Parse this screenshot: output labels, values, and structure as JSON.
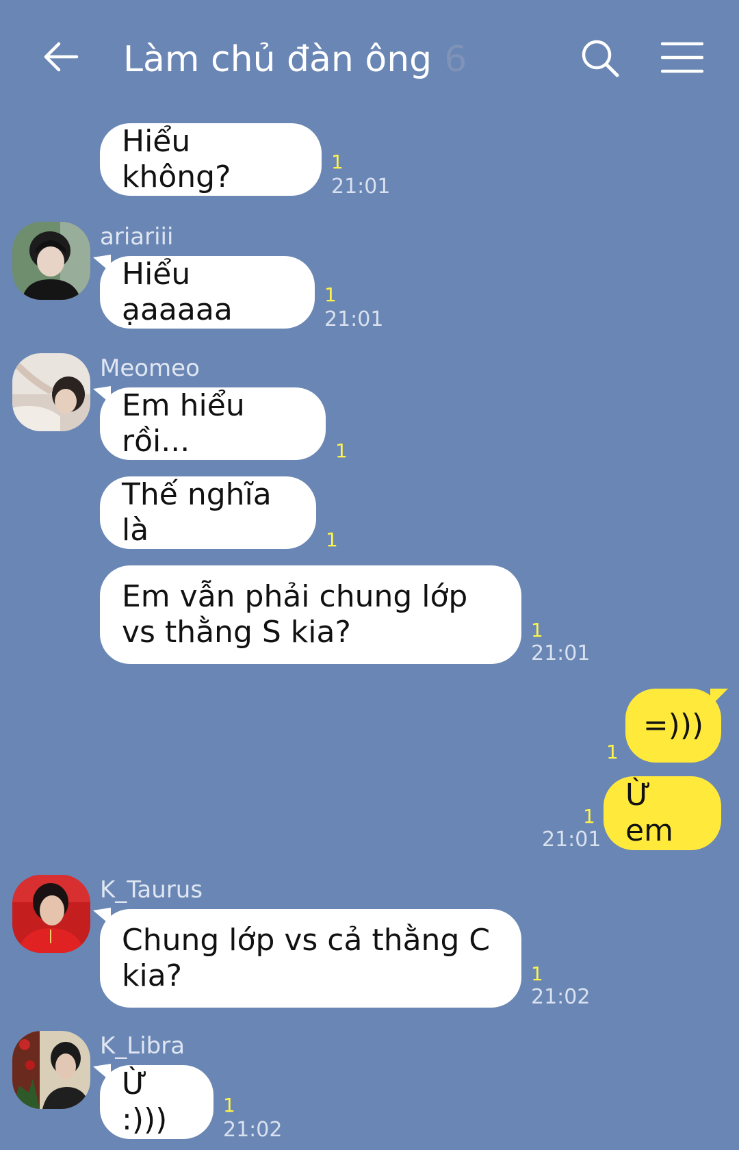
{
  "header": {
    "title": "Làm chủ đàn ông",
    "member_count": "6"
  },
  "messages": [
    {
      "sender": "",
      "text": "Hiểu không?",
      "read": "1",
      "time": "21:01"
    },
    {
      "sender": "ariariii",
      "text": "Hiểu ạaaaaa",
      "read": "1",
      "time": "21:01"
    },
    {
      "sender": "Meomeo",
      "text": "Em hiểu rồi...",
      "read": "1",
      "time": ""
    },
    {
      "sender": "",
      "text": "Thế nghĩa là",
      "read": "1",
      "time": ""
    },
    {
      "sender": "",
      "text": "Em vẫn phải chung lớp vs thằng S kia?",
      "read": "1",
      "time": "21:01"
    },
    {
      "sender": "me",
      "text": "=)))",
      "read": "1",
      "time": ""
    },
    {
      "sender": "me",
      "text": "Ừ em",
      "read": "1",
      "time": "21:01"
    },
    {
      "sender": "K_Taurus",
      "text": "Chung lớp vs cả thằng C kia?",
      "read": "1",
      "time": "21:02"
    },
    {
      "sender": "K_Libra",
      "text": "Ừ :)))",
      "read": "1",
      "time": "21:02"
    }
  ],
  "icons": {
    "back": "arrow-left-icon",
    "search": "search-icon",
    "menu": "hamburger-menu-icon"
  },
  "colors": {
    "background": "#6a86b4",
    "my_bubble": "#ffea3b",
    "other_bubble": "#ffffff",
    "read_count": "#fff44a"
  }
}
